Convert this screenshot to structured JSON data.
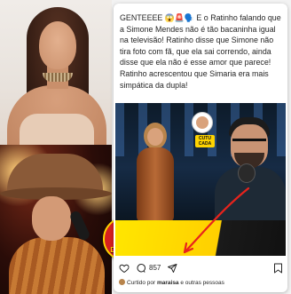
{
  "logo": {
    "line1": "CIRCO",
    "line2": "DANIDIA"
  },
  "post": {
    "caption": "GENTEEEE 😱🚨🗣️ E o Ratinho falando que a Simone Mendes não é tão bacaninha igual na televisão! Ratinho disse que Simone não tira foto com fã, que ela sai correndo, ainda disse que ela não é esse amor que parece! Ratinho acrescentou que Simaria era mais simpática da dupla!",
    "sticker_label": "CUTU CADA",
    "comment_count": "857",
    "liked_prefix": "Curtido por",
    "liked_user": "maraisa",
    "liked_suffix": "e outras pessoas",
    "icons": [
      "heart-icon",
      "comment-icon",
      "share-icon",
      "bookmark-icon"
    ],
    "colors": {
      "accent_yellow": "#ffd400",
      "arrow_red": "#e8231c",
      "logo_red": "#d62020"
    }
  }
}
